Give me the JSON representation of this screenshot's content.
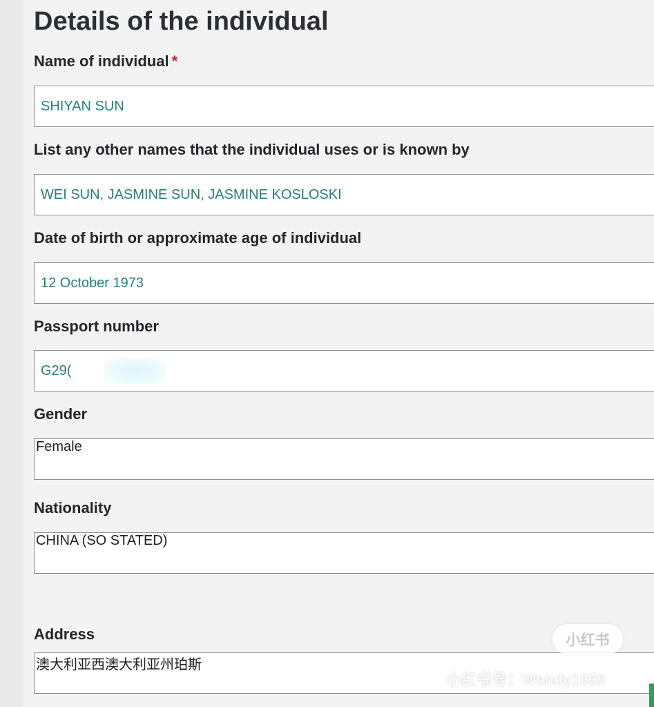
{
  "section": {
    "title": "Details of the individual"
  },
  "fields": {
    "name": {
      "label": "Name of individual",
      "required_marker": "*",
      "value": "SHIYAN SUN"
    },
    "other_names": {
      "label": "List any other names that the individual uses or is known by",
      "value": "WEI SUN, JASMINE SUN, JASMINE KOSLOSKI"
    },
    "dob": {
      "label": "Date of birth or approximate age of individual",
      "value": "12 October 1973"
    },
    "passport": {
      "label": "Passport number",
      "value": "G29("
    },
    "gender": {
      "label": "Gender",
      "value": "Female"
    },
    "nationality": {
      "label": "Nationality",
      "value": "CHINA (SO STATED)"
    },
    "address": {
      "label": "Address",
      "value": "澳大利亚西澳大利亚州珀斯"
    }
  },
  "watermark": {
    "badge": "小红书",
    "text": "小红书号：Wendy1669"
  },
  "colors": {
    "value_teal": "#24807a",
    "required_red": "#c0292f",
    "heading": "#2b2f36"
  }
}
